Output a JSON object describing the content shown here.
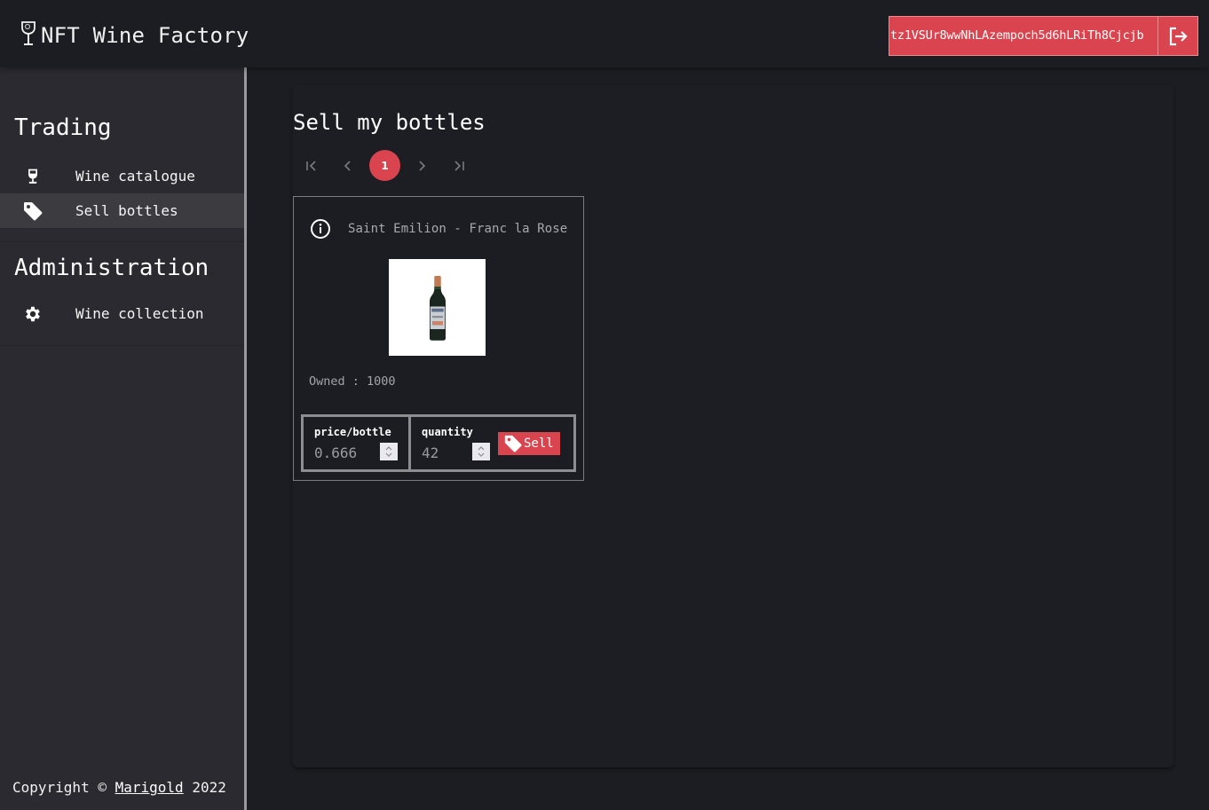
{
  "header": {
    "app_title": "NFT Wine Factory",
    "logo_icon": "wine-glass-logo-icon",
    "wallet_address": "tz1VSUr8wwNhLAzempoch5d6hLRiTh8Cjcjb",
    "logout_icon": "logout-icon",
    "accent_color": "#d9444f"
  },
  "sidebar": {
    "sections": [
      {
        "title": "Trading",
        "items": [
          {
            "label": "Wine catalogue",
            "icon": "wine-glass-icon",
            "active": false
          },
          {
            "label": "Sell bottles",
            "icon": "tag-icon",
            "active": true
          }
        ]
      },
      {
        "title": "Administration",
        "items": [
          {
            "label": "Wine collection",
            "icon": "gear-icon",
            "active": false
          }
        ]
      }
    ],
    "footer": {
      "prefix": "Copyright ©",
      "link_text": "Marigold",
      "year": "2022"
    }
  },
  "main": {
    "title": "Sell my bottles",
    "pagination": {
      "current_page": "1",
      "first_icon": "first-page-icon",
      "prev_icon": "chevron-left-icon",
      "next_icon": "chevron-right-icon",
      "last_icon": "last-page-icon"
    },
    "cards": [
      {
        "name": "Saint Emilion - Franc la Rose",
        "owned_label": "Owned :",
        "owned_value": "1000",
        "price_label": "price/bottle",
        "price_value": "0.666",
        "quantity_label": "quantity",
        "quantity_value": "42",
        "sell_label": "Sell"
      }
    ]
  }
}
